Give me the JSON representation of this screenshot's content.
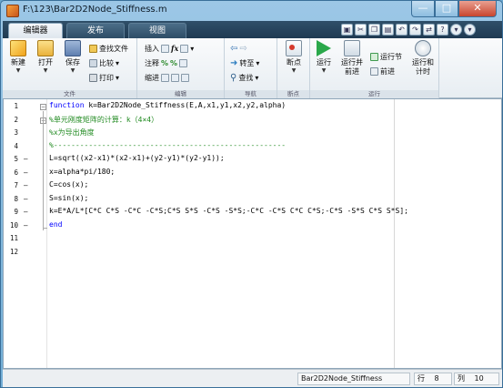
{
  "window": {
    "title": "F:\\123\\Bar2D2Node_Stiffness.m",
    "buttons": {
      "minimize": "—",
      "maximize": "□",
      "close": "✕"
    }
  },
  "tabs": [
    {
      "label": "编辑器",
      "active": true
    },
    {
      "label": "发布",
      "active": false
    },
    {
      "label": "视图",
      "active": false
    }
  ],
  "ribbon": {
    "file_group": {
      "label": "文件",
      "new": "新建",
      "open": "打开",
      "save": "保存",
      "find_files": "查找文件",
      "compare": "比较",
      "print": "打印"
    },
    "edit_group": {
      "label": "编辑",
      "insert": "插入",
      "comment": "注释",
      "indent": "缩进"
    },
    "navigate_group": {
      "label": "导航",
      "goto": "转至",
      "find": "查找"
    },
    "breakpoints_group": {
      "label": "断点",
      "breakpoints": "断点"
    },
    "run_group": {
      "label": "运行",
      "run": "运行",
      "run_advance": "运行并前进",
      "run_section": "运行节",
      "advance": "前进",
      "run_time": "运行和计时"
    }
  },
  "editor": {
    "lines": [
      {
        "num": "1",
        "mark": "",
        "fold": "minus",
        "segments": [
          {
            "t": "function",
            "c": "kw"
          },
          {
            "t": " k=Bar2D2Node_Stiffness(E,A,x1,y1,x2,y2,alpha)",
            "c": ""
          }
        ]
      },
      {
        "num": "2",
        "mark": "",
        "fold": "minus",
        "segments": [
          {
            "t": "%单元刚度矩阵的计算：k（4×4）",
            "c": "cm"
          }
        ]
      },
      {
        "num": "3",
        "mark": "",
        "fold": "",
        "segments": [
          {
            "t": "%x为导出角度",
            "c": "cm"
          }
        ]
      },
      {
        "num": "4",
        "mark": "",
        "fold": "end",
        "segments": [
          {
            "t": "%-----------------------------------------------------",
            "c": "cm"
          }
        ]
      },
      {
        "num": "5",
        "mark": "–",
        "fold": "",
        "segments": [
          {
            "t": "L=sqrt((x2-x1)*(x2-x1)+(y2-y1)*(y2-y1));",
            "c": ""
          }
        ]
      },
      {
        "num": "6",
        "mark": "–",
        "fold": "",
        "segments": [
          {
            "t": "x=alpha*pi/180;",
            "c": ""
          }
        ]
      },
      {
        "num": "7",
        "mark": "–",
        "fold": "",
        "segments": [
          {
            "t": "C=cos(x);",
            "c": ""
          }
        ]
      },
      {
        "num": "8",
        "mark": "–",
        "fold": "",
        "segments": [
          {
            "t": "S=sin(x);",
            "c": ""
          }
        ]
      },
      {
        "num": "9",
        "mark": "–",
        "fold": "",
        "segments": [
          {
            "t": "k=E*A/L*[C*C C*S -C*C -C*S;C*S S*S -C*S -S*S;-C*C -C*S C*C C*S;-C*S -S*S C*S S*S];",
            "c": ""
          }
        ]
      },
      {
        "num": "10",
        "mark": "–",
        "fold": "endline",
        "segments": [
          {
            "t": "end",
            "c": "kw"
          }
        ]
      },
      {
        "num": "11",
        "mark": "",
        "fold": "",
        "segments": []
      },
      {
        "num": "12",
        "mark": "",
        "fold": "",
        "segments": []
      }
    ]
  },
  "statusbar": {
    "function_name": "Bar2D2Node_Stiffness",
    "row_label": "行",
    "row_value": "8",
    "col_label": "列",
    "col_value": "10"
  }
}
